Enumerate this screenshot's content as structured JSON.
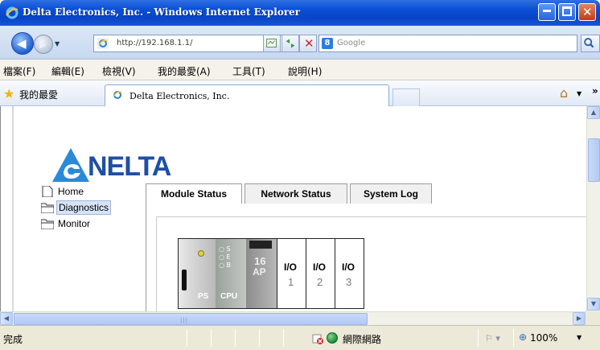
{
  "window": {
    "title": "Delta Electronics, Inc. - Windows Internet Explorer"
  },
  "address_bar": {
    "url": "http://192.168.1.1/"
  },
  "search": {
    "engine": "Google",
    "placeholder": "Google"
  },
  "menu": {
    "items": [
      "檔案(F)",
      "編輯(E)",
      "檢視(V)",
      "我的最愛(A)",
      "工具(T)",
      "說明(H)"
    ]
  },
  "favorites_bar": {
    "label": "我的最愛",
    "tab_title": "Delta Electronics, Inc."
  },
  "page": {
    "logo_text": "NELTA",
    "nav": [
      {
        "label": "Home",
        "icon": "page-icon",
        "selected": false
      },
      {
        "label": "Diagnostics",
        "icon": "folder-icon",
        "selected": true
      },
      {
        "label": "Monitor",
        "icon": "folder-icon",
        "selected": false
      }
    ],
    "tabs": [
      {
        "label": "Module Status",
        "active": true
      },
      {
        "label": "Network Status",
        "active": false
      },
      {
        "label": "System Log",
        "active": false
      }
    ],
    "rack": {
      "modules": [
        {
          "label": "PS",
          "kind": "power-supply"
        },
        {
          "label": "CPU",
          "kind": "cpu",
          "leds": [
            "S",
            "E",
            "B"
          ]
        },
        {
          "label": "16",
          "sublabel": "AP",
          "kind": "io-module"
        },
        {
          "label": "I/O",
          "sublabel": "1",
          "kind": "empty-slot"
        },
        {
          "label": "I/O",
          "sublabel": "2",
          "kind": "empty-slot"
        },
        {
          "label": "I/O",
          "sublabel": "3",
          "kind": "empty-slot"
        }
      ]
    }
  },
  "status_bar": {
    "status": "完成",
    "zone": "網際網路",
    "zoom": "100%"
  },
  "colors": {
    "titlebar": "#0845c6",
    "delta_blue": "#1e4fa4",
    "chrome_bg": "#ece9d8"
  }
}
